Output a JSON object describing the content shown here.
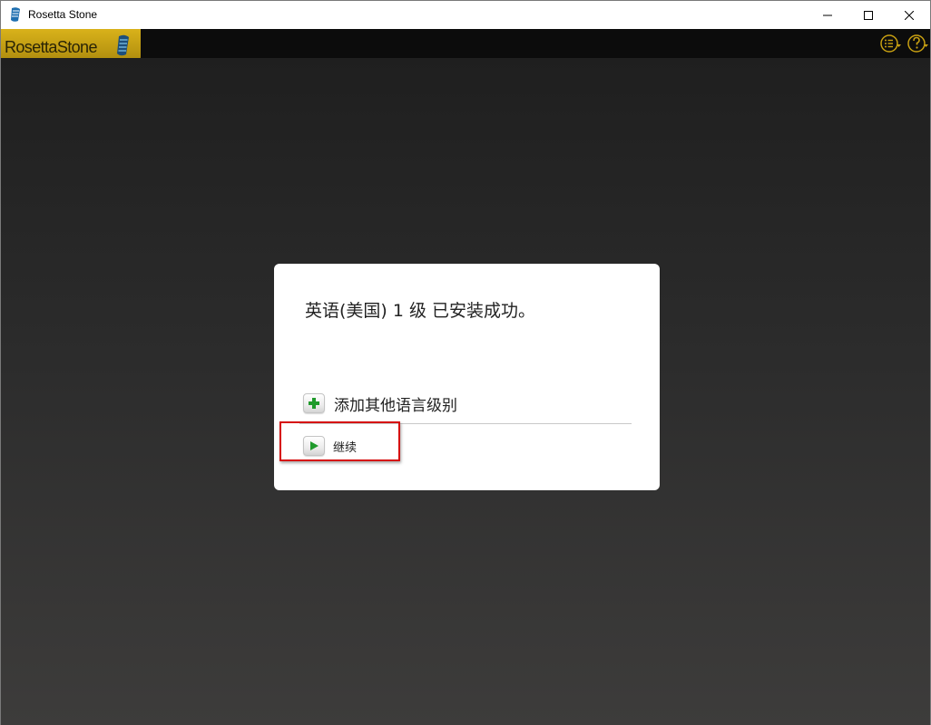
{
  "window": {
    "title": "Rosetta Stone"
  },
  "logo": {
    "text_a": "Rosetta",
    "text_b": "Stone",
    "colors": {
      "gold": "#c8a012",
      "gold_dark": "#7d6308"
    }
  },
  "toolbar": {
    "menu_icon": "list-menu-icon",
    "help_icon": "help-icon"
  },
  "dialog": {
    "message": "英语(美国) 1 级 已安装成功。",
    "options": [
      {
        "label": "添加其他语言级别",
        "icon": "plus-icon",
        "icon_color": "#1f9a2b"
      },
      {
        "label": "继续",
        "icon": "play-icon",
        "icon_color": "#1f9a2b"
      }
    ]
  },
  "highlight": {
    "target": "继续",
    "color": "#d60f0f"
  }
}
